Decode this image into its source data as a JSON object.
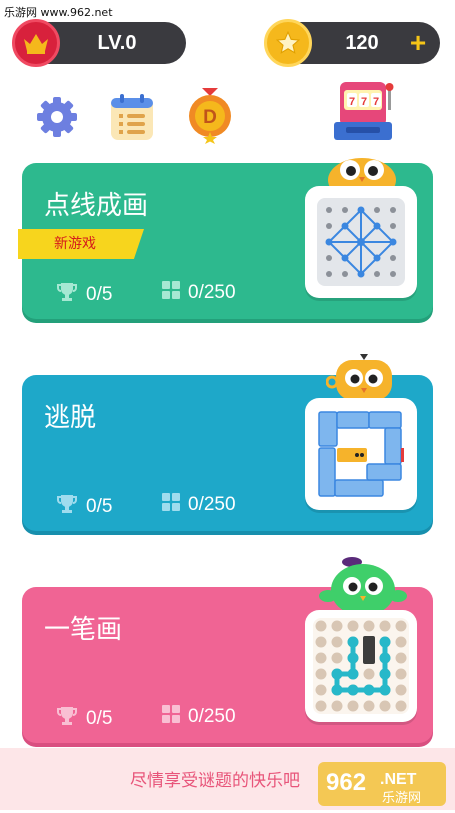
{
  "watermark": "乐游网 www.962.net",
  "header": {
    "level": "LV.0",
    "coins": "120",
    "plus": "+"
  },
  "toolbar": {
    "icons": [
      "gear-icon",
      "calendar-list-icon",
      "d-medal-icon",
      "slot-machine-icon"
    ]
  },
  "games": [
    {
      "title": "点线成画",
      "tag": "新游戏",
      "trophies": "0/5",
      "levels": "0/250",
      "color": "#2db98e",
      "shade": "#23a07a"
    },
    {
      "title": "逃脱",
      "trophies": "0/5",
      "levels": "0/250",
      "color": "#1ea8c9",
      "shade": "#178fad"
    },
    {
      "title": "一笔画",
      "trophies": "0/5",
      "levels": "0/250",
      "color": "#f06494",
      "shade": "#d94f80"
    }
  ],
  "footer": {
    "slogan": "尽情享受谜题的快乐吧",
    "logo_text": "962",
    "logo_net": ".NET",
    "logo_sub": "乐游网"
  }
}
